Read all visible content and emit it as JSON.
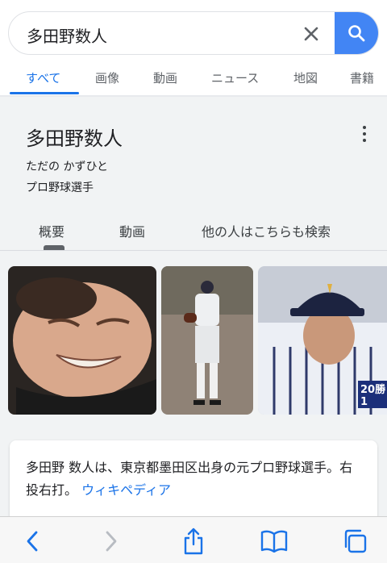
{
  "search": {
    "query": "多田野数人"
  },
  "tabs": [
    {
      "label": "すべて",
      "active": true
    },
    {
      "label": "画像"
    },
    {
      "label": "動画"
    },
    {
      "label": "ニュース"
    },
    {
      "label": "地図"
    },
    {
      "label": "書籍"
    }
  ],
  "knowledge_panel": {
    "title": "多田野数人",
    "reading": "ただの かずひと",
    "description": "プロ野球選手",
    "subtabs": [
      "概要",
      "動画",
      "他の人はこちらも検索"
    ]
  },
  "images": [
    {
      "icon": "photo-grimacing-face"
    },
    {
      "icon": "photo-baseball-pitcher"
    },
    {
      "icon": "photo-player-uniform-20"
    }
  ],
  "image3_badge": "20勝1",
  "summary": {
    "text": "多田野 数人は、東京都墨田区出身の元プロ野球選手。右投右打。",
    "link": "ウィキペディア"
  },
  "colors": {
    "accent": "#1a73e8",
    "search_button": "#4285f4"
  }
}
